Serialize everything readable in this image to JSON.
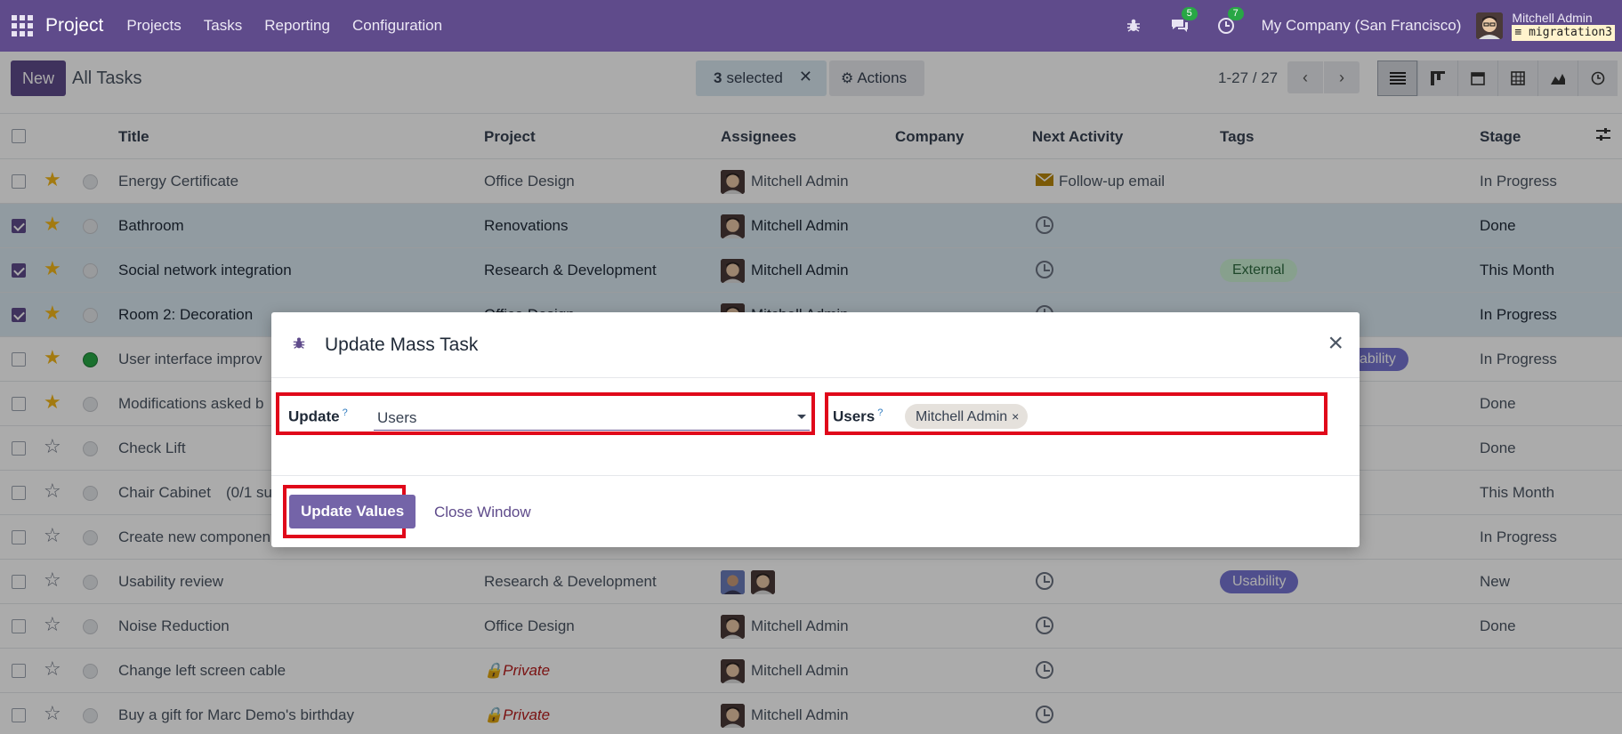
{
  "navbar": {
    "app": "Project",
    "menu": [
      "Projects",
      "Tasks",
      "Reporting",
      "Configuration"
    ],
    "chat_count": "5",
    "activity_count": "7",
    "company": "My Company (San Francisco)",
    "user": "Mitchell Admin",
    "database": "migratation3"
  },
  "control": {
    "new_label": "New",
    "title": "All Tasks",
    "selected_count": "3",
    "selected_text": "selected",
    "actions_label": "Actions",
    "pager": "1-27 / 27"
  },
  "columns": [
    "Title",
    "Project",
    "Assignees",
    "Company",
    "Next Activity",
    "Tags",
    "Stage"
  ],
  "rows": [
    {
      "title": "Energy Certificate",
      "project": "Office Design",
      "assignee": "Mitchell Admin",
      "activity": "Follow-up email",
      "tag": "",
      "stage": "In Progress"
    },
    {
      "title": "Bathroom",
      "project": "Renovations",
      "assignee": "Mitchell Admin",
      "activity": "",
      "tag": "",
      "stage": "Done"
    },
    {
      "title": "Social network integration",
      "project": "Research & Development",
      "assignee": "Mitchell Admin",
      "activity": "",
      "tag": "External",
      "stage": "This Month"
    },
    {
      "title": "Room 2: Decoration",
      "project": "Office Design",
      "assignee": "Mitchell Admin",
      "activity": "",
      "tag": "",
      "stage": "In Progress"
    },
    {
      "title": "User interface improv",
      "project": "",
      "assignee": "",
      "activity": "",
      "tag": "sability",
      "stage": "In Progress"
    },
    {
      "title": "Modifications asked b",
      "project": "",
      "assignee": "",
      "activity": "",
      "tag": "",
      "stage": "Done"
    },
    {
      "title": "Check Lift",
      "project": "",
      "assignee": "",
      "activity": "",
      "tag": "",
      "stage": "Done"
    },
    {
      "title": "Chair Cabinet",
      "title_extra": "(0/1 su",
      "project": "",
      "assignee": "",
      "activity": "",
      "tag": "",
      "stage": "This Month"
    },
    {
      "title": "Create new componen",
      "project": "",
      "assignee": "",
      "activity": "",
      "tag": "",
      "stage": "In Progress"
    },
    {
      "title": "Usability review",
      "project": "Research & Development",
      "assignee": "",
      "activity": "",
      "tag": "Usability",
      "stage": "New"
    },
    {
      "title": "Noise Reduction",
      "project": "Office Design",
      "assignee": "Mitchell Admin",
      "activity": "",
      "tag": "",
      "stage": "Done"
    },
    {
      "title": "Change left screen cable",
      "project": "Private",
      "assignee": "Mitchell Admin",
      "activity": "",
      "tag": "",
      "stage": ""
    },
    {
      "title": "Buy a gift for Marc Demo's birthday",
      "project": "Private",
      "assignee": "Mitchell Admin",
      "activity": "",
      "tag": "",
      "stage": ""
    }
  ],
  "modal": {
    "title": "Update Mass Task",
    "update_label": "Update",
    "help_mark": "?",
    "update_value": "Users",
    "users_label": "Users",
    "users_chip": "Mitchell Admin",
    "chip_remove": "×",
    "primary_button": "Update Values",
    "close_link": "Close Window",
    "close_icon": "×"
  },
  "colors": {
    "brand": "#5f4b8b",
    "highlight": "#e0081a",
    "selected_row": "#d9e8f1"
  }
}
